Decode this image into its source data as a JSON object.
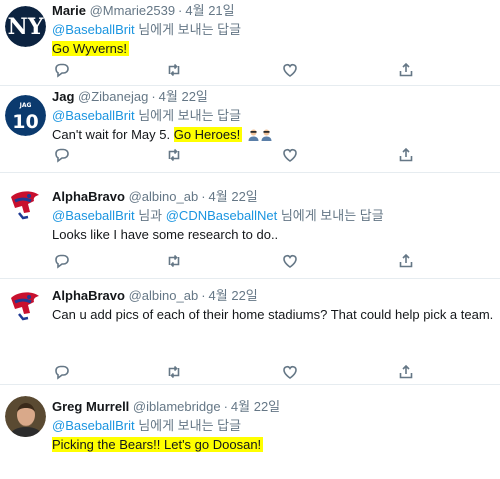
{
  "tweets": [
    {
      "name": "Marie",
      "handle": "@Mmarie2539",
      "date": "4월 21일",
      "reply_mention": "@BaseballBrit",
      "reply_suffix": " 님에게 보내는 답글",
      "text": "Go Wyverns!",
      "avatar_icon": "yankees-logo-icon"
    },
    {
      "name": "Jag",
      "handle": "@Zibanejag",
      "date": "4월 22일",
      "reply_mention": "@BaseballBrit",
      "reply_suffix": " 님에게 보내는 답글",
      "text_plain": "Can't wait for May 5. ",
      "text_highlight": "Go Heroes!",
      "avatar_label": "JAG",
      "avatar_number": "10",
      "avatar_icon": "jersey-number-icon"
    },
    {
      "name": "AlphaBravo",
      "handle": "@albino_ab",
      "date": "4월 22일",
      "reply_mention": "@BaseballBrit",
      "reply_between": " 님과 ",
      "reply_mention2": "@CDNBaseballNet",
      "reply_suffix": " 님에게 보내는 답글",
      "text": "Looks like I have some research to do..",
      "avatar_icon": "mascot-logo-icon"
    },
    {
      "name": "AlphaBravo",
      "handle": "@albino_ab",
      "date": "4월 22일",
      "text": "Can u add pics of each of their home stadiums? That could help pick a team.",
      "avatar_icon": "mascot-logo-icon"
    },
    {
      "name": "Greg Murrell",
      "handle": "@iblamebridge",
      "date": "4월 22일",
      "reply_mention": "@BaseballBrit",
      "reply_suffix": " 님에게 보내는 답글",
      "text": "Picking the Bears!!  Let's go Doosan!",
      "avatar_icon": "profile-photo-icon"
    }
  ],
  "actions": [
    "reply-icon",
    "retweet-icon",
    "like-icon",
    "share-icon"
  ],
  "colors": {
    "link": "#1b95e0",
    "meta": "#657786",
    "highlight": "#ffff00",
    "divider": "#e6ecf0"
  }
}
